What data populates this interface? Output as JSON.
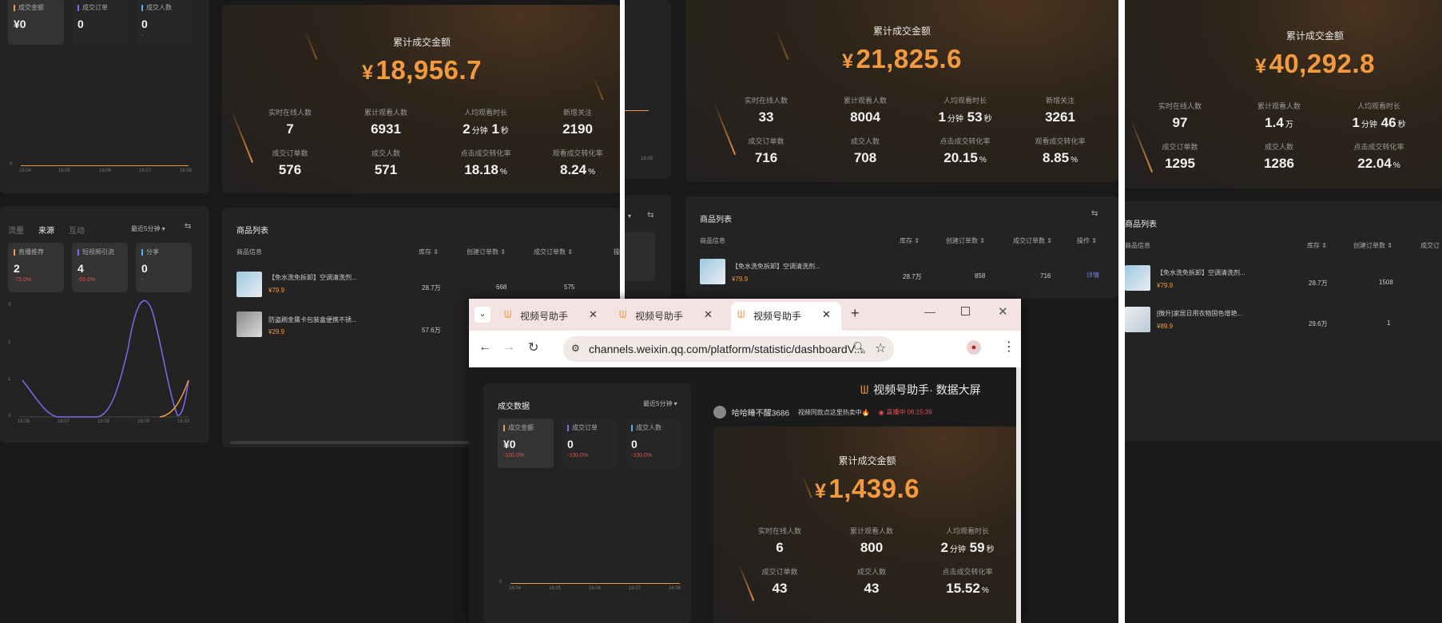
{
  "left_panel": {
    "kpis": [
      {
        "label": "成交金额",
        "value": "¥0",
        "color": "#f39a3e"
      },
      {
        "label": "成交订单",
        "value": "0",
        "color": "#7a6cf0"
      },
      {
        "label": "成交人数",
        "value": "0",
        "color": "#4fb3f0"
      }
    ],
    "times": [
      "16:04",
      "16:05",
      "16:06",
      "16:07",
      "16:08"
    ],
    "zero": "0",
    "total_title": "累计成交金额",
    "total": "18,956.7",
    "stats": [
      {
        "label": "实时在线人数",
        "value": "7",
        "unit": ""
      },
      {
        "label": "累计观看人数",
        "value": "6931",
        "unit": ""
      },
      {
        "label": "人均观看时长",
        "value": "2",
        "unit": "分钟",
        "value2": "1",
        "unit2": "秒"
      },
      {
        "label": "新增关注",
        "value": "2190",
        "unit": ""
      },
      {
        "label": "成交订单数",
        "value": "576",
        "unit": ""
      },
      {
        "label": "成交人数",
        "value": "571",
        "unit": ""
      },
      {
        "label": "点击成交转化率",
        "value": "18.18",
        "unit": "%"
      },
      {
        "label": "观看成交转化率",
        "value": "8.24",
        "unit": "%"
      }
    ],
    "traffic_tabs": [
      "流量",
      "来源",
      "互动"
    ],
    "range": "最近5分钟",
    "sources": [
      {
        "label": "直播推荐",
        "value": "2",
        "change": "-75.0%",
        "color": "#f39a3e"
      },
      {
        "label": "短视频引流",
        "value": "4",
        "change": "-55.6%",
        "color": "#7a6cf0"
      },
      {
        "label": "分享",
        "value": "0",
        "change": "-",
        "color": "#4fb3f0"
      }
    ],
    "source_y": [
      "3",
      "2",
      "1",
      "0"
    ],
    "source_x": [
      "16:06",
      "16:07",
      "16:08",
      "16:09",
      "16:10"
    ],
    "products_title": "商品列表",
    "product_headers": [
      "商品信息",
      "库存",
      "创建订单数",
      "成交订单数",
      "操"
    ],
    "products": [
      {
        "name": "【免水洗免拆卸】空调清洗剂...",
        "price": "¥79.9",
        "stock": "28.7万",
        "created": "668",
        "done": "575"
      },
      {
        "name": "防盗刷金属卡包装盒便携不锈...",
        "price": "¥29.9",
        "stock": "57.6万",
        "created": "",
        "done": ""
      }
    ]
  },
  "mid_panel": {
    "total_title": "累计成交金额",
    "total": "21,825.6",
    "stats": [
      {
        "label": "实时在线人数",
        "value": "33",
        "unit": ""
      },
      {
        "label": "累计观看人数",
        "value": "8004",
        "unit": ""
      },
      {
        "label": "人均观看时长",
        "value": "1",
        "unit": "分钟",
        "value2": "53",
        "unit2": "秒"
      },
      {
        "label": "新增关注",
        "value": "3261",
        "unit": ""
      },
      {
        "label": "成交订单数",
        "value": "716",
        "unit": ""
      },
      {
        "label": "成交人数",
        "value": "708",
        "unit": ""
      },
      {
        "label": "点击成交转化率",
        "value": "20.15",
        "unit": "%"
      },
      {
        "label": "观看成交转化率",
        "value": "8.85",
        "unit": "%"
      }
    ],
    "products_title": "商品列表",
    "product_headers": [
      "商品信息",
      "库存",
      "创建订单数",
      "成交订单数",
      "操作"
    ],
    "products": [
      {
        "name": "【免水洗免拆卸】空调清洗剂...",
        "price": "¥79.9",
        "stock": "28.7万",
        "created": "858",
        "done": "716",
        "action": "详情"
      }
    ],
    "edge_time": "16:08"
  },
  "right_panel": {
    "total_title": "累计成交金额",
    "total": "40,292.8",
    "stats": [
      {
        "label": "实时在线人数",
        "value": "97",
        "unit": ""
      },
      {
        "label": "累计观看人数",
        "value": "1.4",
        "unit": "万"
      },
      {
        "label": "人均观看时长",
        "value": "1",
        "unit": "分钟",
        "value2": "46",
        "unit2": "秒"
      },
      {
        "label": "成交订单数",
        "value": "1295",
        "unit": ""
      },
      {
        "label": "成交人数",
        "value": "1286",
        "unit": ""
      },
      {
        "label": "点击成交转化率",
        "value": "22.04",
        "unit": "%"
      }
    ],
    "products_title": "商品列表",
    "product_headers": [
      "商品信息",
      "库存",
      "创建订单数",
      "成交订"
    ],
    "products": [
      {
        "name": "【免水洗免拆卸】空调清洗剂...",
        "price": "¥79.9",
        "stock": "28.7万",
        "created": "1508"
      },
      {
        "name": "[微升]家居日用衣物固色增艳...",
        "price": "¥89.9",
        "stock": "29.6万",
        "created": "1"
      }
    ]
  },
  "browser": {
    "tabs": [
      "视频号助手",
      "视频号助手",
      "视频号助手"
    ],
    "url": "channels.weixin.qq.com/platform/statistic/dashboardV...",
    "brand": "视频号助手· 数据大屏",
    "deal_title": "成交数据",
    "range": "最近5分钟",
    "kpis": [
      {
        "label": "成交金额",
        "value": "¥0",
        "change": "-100.0%",
        "color": "#f39a3e"
      },
      {
        "label": "成交订单",
        "value": "0",
        "change": "-100.0%",
        "color": "#7a6cf0"
      },
      {
        "label": "成交人数",
        "value": "0",
        "change": "-100.0%",
        "color": "#4fb3f0"
      }
    ],
    "times": [
      "16:04",
      "16:05",
      "16:06",
      "16:07",
      "16:08"
    ],
    "zero": "0",
    "user": "哈哈睡不醒3686",
    "promo": "视频同款点这里热卖中🔥",
    "live": "直播中 06:15:39",
    "total_title": "累计成交金额",
    "total": "1,439.6",
    "stats": [
      {
        "label": "实时在线人数",
        "value": "6",
        "unit": ""
      },
      {
        "label": "累计观看人数",
        "value": "800",
        "unit": ""
      },
      {
        "label": "人均观看时长",
        "value": "2",
        "unit": "分钟",
        "value2": "59",
        "unit2": "秒"
      },
      {
        "label": "成交订单数",
        "value": "43",
        "unit": ""
      },
      {
        "label": "成交人数",
        "value": "43",
        "unit": ""
      },
      {
        "label": "点击成交转化率",
        "value": "15.52",
        "unit": "%"
      }
    ]
  }
}
